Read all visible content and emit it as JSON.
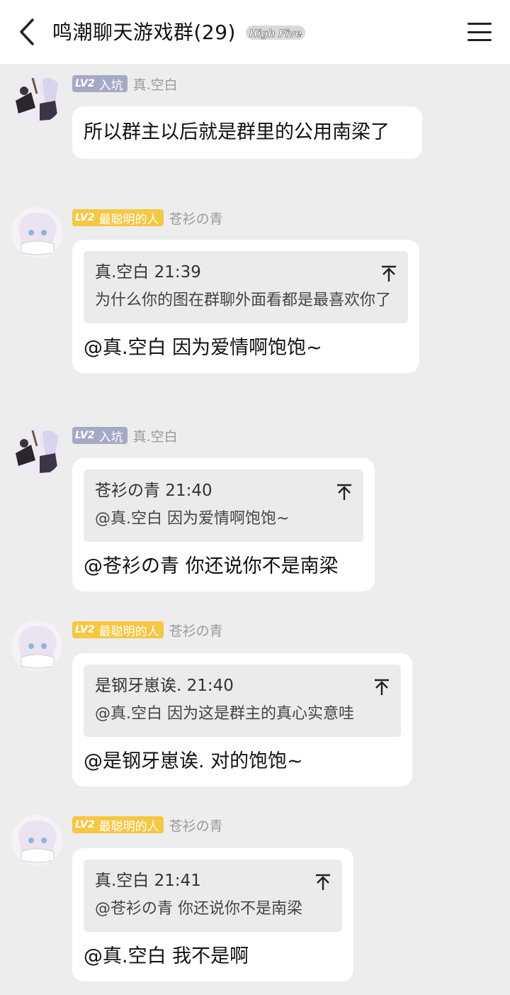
{
  "header": {
    "title": "鸣潮聊天游戏群(29)",
    "badge_text": "High Five",
    "back_icon": "chevron-left-icon",
    "menu_icon": "hamburger-menu-icon"
  },
  "messages": [
    {
      "level": "LV2",
      "title": "入坑",
      "nickname": "真.空白",
      "text": "所以群主以后就是群里的公用南梁了"
    },
    {
      "level": "LV2",
      "title": "最聪明的人",
      "nickname": "苍衫の青",
      "quote": {
        "author_time": "真.空白 21:39",
        "text": "为什么你的图在群聊外面看都是最喜欢你了"
      },
      "text": "@真.空白 因为爱情啊饱饱~"
    },
    {
      "level": "LV2",
      "title": "入坑",
      "nickname": "真.空白",
      "quote": {
        "author_time": "苍衫の青 21:40",
        "text": "@真.空白 因为爱情啊饱饱~"
      },
      "text": "@苍衫の青 你还说你不是南梁"
    },
    {
      "level": "LV2",
      "title": "最聪明的人",
      "nickname": "苍衫の青",
      "quote": {
        "author_time": "是钢牙崽诶. 21:40",
        "text": "@真.空白 因为这是群主的真心实意哇"
      },
      "text": "@是钢牙崽诶. 对的饱饱~"
    },
    {
      "level": "LV2",
      "title": "最聪明的人",
      "nickname": "苍衫の青",
      "quote": {
        "author_time": "真.空白 21:41",
        "text": "@苍衫の青 你还说你不是南梁"
      },
      "text": "@真.空白 我不是啊"
    }
  ]
}
